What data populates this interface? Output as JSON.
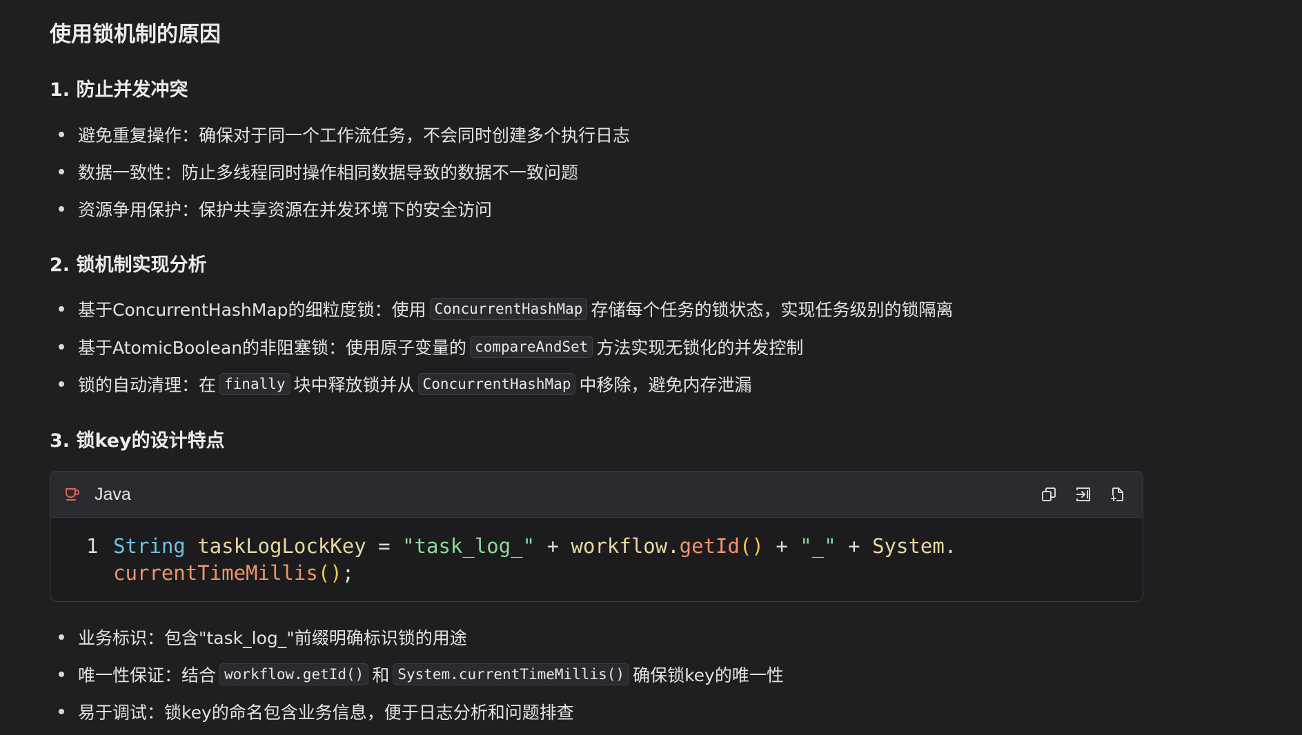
{
  "title": "使用锁机制的原因",
  "sections": [
    {
      "heading": "1. 防止并发冲突",
      "bullets": [
        [
          "避免重复操作：确保对于同一个工作流任务，不会同时创建多个执行日志"
        ],
        [
          "数据一致性：防止多线程同时操作相同数据导致的数据不一致问题"
        ],
        [
          "资源争用保护：保护共享资源在并发环境下的安全访问"
        ]
      ]
    },
    {
      "heading": "2. 锁机制实现分析",
      "bullets": [
        [
          "基于ConcurrentHashMap的细粒度锁：使用",
          "ConcurrentHashMap",
          "存储每个任务的锁状态，实现任务级别的锁隔离"
        ],
        [
          "基于AtomicBoolean的非阻塞锁：使用原子变量的",
          "compareAndSet",
          "方法实现无锁化的并发控制"
        ],
        [
          "锁的自动清理：在",
          "finally",
          "块中释放锁并从",
          "ConcurrentHashMap",
          "中移除，避免内存泄漏"
        ]
      ]
    },
    {
      "heading": "3. 锁key的设计特点",
      "bullets": [
        [
          "业务标识：包含\"task_log_\"前缀明确标识锁的用途"
        ],
        [
          "唯一性保证：结合",
          "workflow.getId()",
          "和",
          "System.currentTimeMillis()",
          "确保锁key的唯一性"
        ],
        [
          "易于调试：锁key的命名包含业务信息，便于日志分析和问题排查"
        ]
      ]
    }
  ],
  "code_block": {
    "language": "Java",
    "line_number": "1",
    "line1": {
      "t1": "String",
      "t2": " taskLogLockKey",
      "t3": " = ",
      "t4": "\"task_log_\"",
      "t5": " + ",
      "t6": "workflow.",
      "t7": "getId",
      "t8": "()",
      "t9": " + ",
      "t10": "\"_\"",
      "t11": " + ",
      "t12": "System."
    },
    "line2": {
      "t1": "currentTimeMillis",
      "t2": "()",
      "t3": ";"
    },
    "icons": [
      "coffee-cup-icon",
      "copy-icon",
      "insert-icon",
      "new-file-icon"
    ]
  },
  "colors": {
    "background": "#1f1f21",
    "code_header": "#2a2b2f",
    "keyword_type": "#6fc3df",
    "string": "#8ed99f",
    "function": "#f0946a",
    "identifier": "#e8d9a0",
    "java_icon": "#e0605a"
  }
}
